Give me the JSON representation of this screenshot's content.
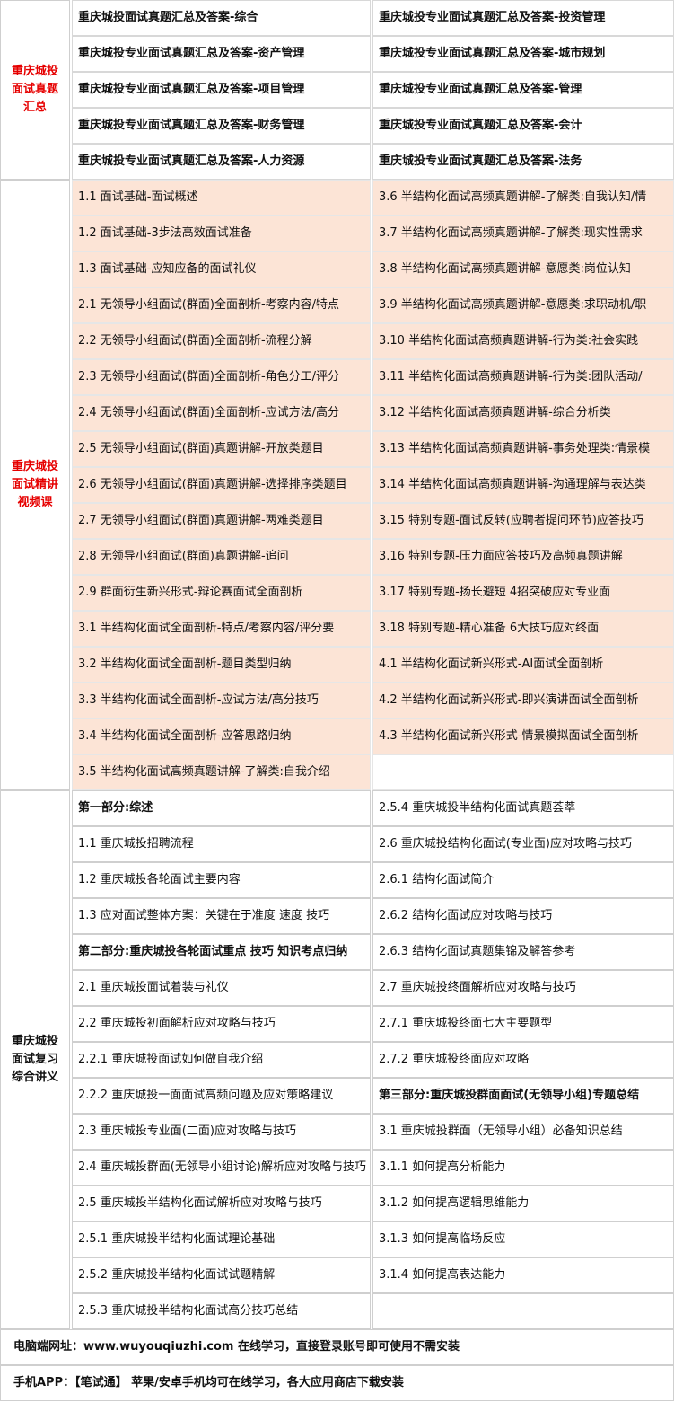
{
  "section1": {
    "label": "重庆城投\n面试真题\n汇总",
    "rows": [
      [
        "重庆城投面试真题汇总及答案-综合",
        "重庆城投专业面试真题汇总及答案-投资管理"
      ],
      [
        "重庆城投专业面试真题汇总及答案-资产管理",
        "重庆城投专业面试真题汇总及答案-城市规划"
      ],
      [
        "重庆城投专业面试真题汇总及答案-项目管理",
        "重庆城投专业面试真题汇总及答案-管理"
      ],
      [
        "重庆城投专业面试真题汇总及答案-财务管理",
        "重庆城投专业面试真题汇总及答案-会计"
      ],
      [
        "重庆城投专业面试真题汇总及答案-人力资源",
        "重庆城投专业面试真题汇总及答案-法务"
      ]
    ]
  },
  "section2": {
    "label": "重庆城投\n面试精讲\n视频课",
    "rows": [
      [
        "1.1 面试基础-面试概述",
        "3.6 半结构化面试高频真题讲解-了解类:自我认知/情"
      ],
      [
        "1.2 面试基础-3步法高效面试准备",
        "3.7 半结构化面试高频真题讲解-了解类:现实性需求"
      ],
      [
        "1.3 面试基础-应知应备的面试礼仪",
        "3.8 半结构化面试高频真题讲解-意愿类:岗位认知"
      ],
      [
        "2.1 无领导小组面试(群面)全面剖析-考察内容/特点",
        "3.9 半结构化面试高频真题讲解-意愿类:求职动机/职"
      ],
      [
        "2.2 无领导小组面试(群面)全面剖析-流程分解",
        "3.10 半结构化面试高频真题讲解-行为类:社会实践"
      ],
      [
        "2.3 无领导小组面试(群面)全面剖析-角色分工/评分",
        "3.11 半结构化面试高频真题讲解-行为类:团队活动/"
      ],
      [
        "2.4 无领导小组面试(群面)全面剖析-应试方法/高分",
        "3.12 半结构化面试高频真题讲解-综合分析类"
      ],
      [
        "2.5 无领导小组面试(群面)真题讲解-开放类题目",
        "3.13 半结构化面试高频真题讲解-事务处理类:情景模"
      ],
      [
        "2.6 无领导小组面试(群面)真题讲解-选择排序类题目",
        "3.14 半结构化面试高频真题讲解-沟通理解与表达类"
      ],
      [
        "2.7 无领导小组面试(群面)真题讲解-两难类题目",
        "3.15 特别专题-面试反转(应聘者提问环节)应答技巧"
      ],
      [
        "2.8 无领导小组面试(群面)真题讲解-追问",
        "3.16 特别专题-压力面应答技巧及高频真题讲解"
      ],
      [
        "2.9 群面衍生新兴形式-辩论赛面试全面剖析",
        "3.17 特别专题-扬长避短 4招突破应对专业面"
      ],
      [
        "3.1 半结构化面试全面剖析-特点/考察内容/评分要",
        "3.18 特别专题-精心准备 6大技巧应对终面"
      ],
      [
        "3.2 半结构化面试全面剖析-题目类型归纳",
        "4.1 半结构化面试新兴形式-AI面试全面剖析"
      ],
      [
        "3.3 半结构化面试全面剖析-应试方法/高分技巧",
        "4.2 半结构化面试新兴形式-即兴演讲面试全面剖析"
      ],
      [
        "3.4 半结构化面试全面剖析-应答思路归纳",
        "4.3 半结构化面试新兴形式-情景模拟面试全面剖析"
      ],
      [
        "3.5 半结构化面试高频真题讲解-了解类:自我介绍",
        ""
      ]
    ]
  },
  "section3": {
    "label": "重庆城投\n面试复习\n综合讲义",
    "rows": [
      [
        "第一部分:综述",
        "2.5.4 重庆城投半结构化面试真题荟萃"
      ],
      [
        "1.1 重庆城投招聘流程",
        "2.6 重庆城投结构化面试(专业面)应对攻略与技巧"
      ],
      [
        "1.2 重庆城投各轮面试主要内容",
        "2.6.1 结构化面试简介"
      ],
      [
        "1.3 应对面试整体方案：关键在于准度 速度 技巧",
        "2.6.2 结构化面试应对攻略与技巧"
      ],
      [
        "第二部分:重庆城投各轮面试重点 技巧 知识考点归纳",
        "2.6.3 结构化面试真题集锦及解答参考"
      ],
      [
        "2.1 重庆城投面试着装与礼仪",
        "2.7 重庆城投终面解析应对攻略与技巧"
      ],
      [
        "2.2 重庆城投初面解析应对攻略与技巧",
        "2.7.1 重庆城投终面七大主要题型"
      ],
      [
        "2.2.1 重庆城投面试如何做自我介绍",
        "2.7.2 重庆城投终面应对攻略"
      ],
      [
        "2.2.2 重庆城投一面面试高频问题及应对策略建议",
        "第三部分:重庆城投群面面试(无领导小组)专题总结"
      ],
      [
        "2.3 重庆城投专业面(二面)应对攻略与技巧",
        "3.1 重庆城投群面（无领导小组）必备知识总结"
      ],
      [
        "2.4 重庆城投群面(无领导小组讨论)解析应对攻略与技巧",
        "3.1.1  如何提高分析能力"
      ],
      [
        "2.5 重庆城投半结构化面试解析应对攻略与技巧",
        "3.1.2  如何提高逻辑思维能力"
      ],
      [
        "2.5.1 重庆城投半结构化面试理论基础",
        "3.1.3  如何提高临场反应"
      ],
      [
        "2.5.2 重庆城投半结构化面试试题精解",
        "3.1.4  如何提高表达能力"
      ],
      [
        "2.5.3 重庆城投半结构化面试高分技巧总结",
        ""
      ]
    ]
  },
  "footer": {
    "web": "电脑端网址：www.wuyouqiuzhi.com 在线学习，直接登录账号即可使用不需安装",
    "app": "手机APP：【笔试通】 苹果/安卓手机均可在线学习，各大应用商店下载安装"
  }
}
